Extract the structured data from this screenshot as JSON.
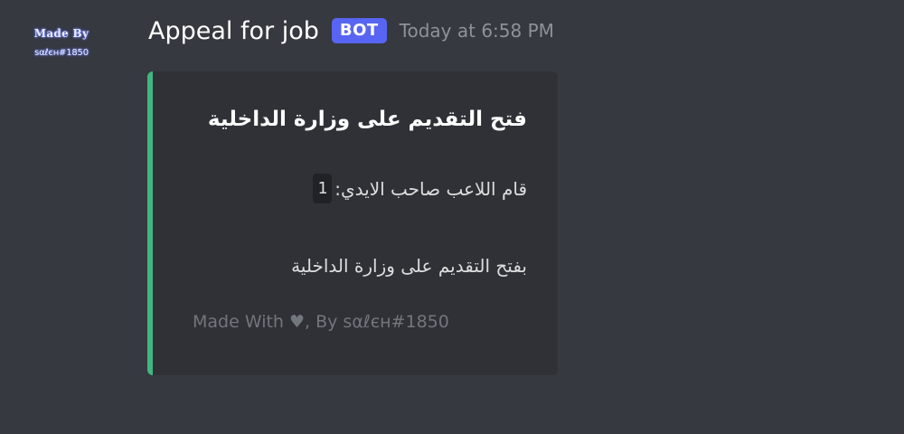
{
  "avatar": {
    "line1": "Made By",
    "line2": "sαℓєн#1850"
  },
  "message": {
    "username": "Appeal for job",
    "bot_tag": "BOT",
    "timestamp": "Today at 6:58 PM"
  },
  "embed": {
    "accent_color": "#43b581",
    "title": "فتح التقديم على وزارة الداخلية",
    "field_text": "قام اللاعب صاحب الايدي:",
    "field_value": "1",
    "description": "بفتح التقديم على وزارة الداخلية",
    "footer": "Made With ♥, By sαℓєн#1850"
  },
  "colors": {
    "background": "#36393f",
    "embed_bg": "#2f3136",
    "bot_tag": "#5865f2",
    "timestamp": "#8e9297"
  }
}
